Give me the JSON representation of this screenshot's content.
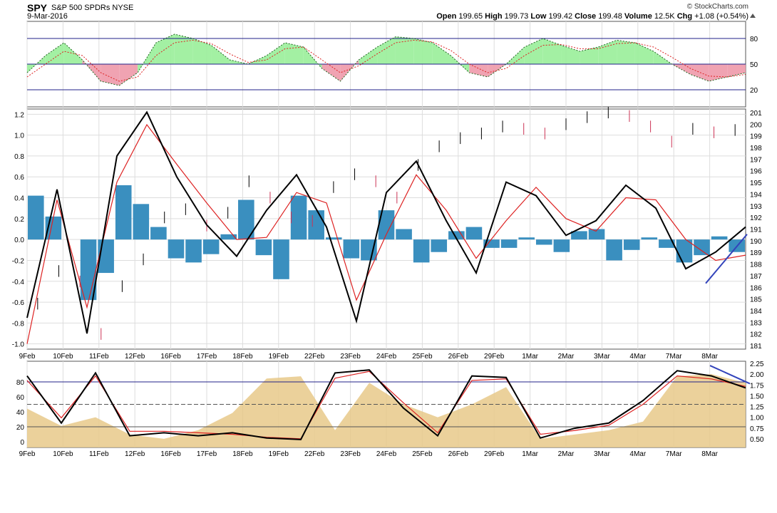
{
  "header": {
    "symbol": "SPY",
    "description": "S&P 500 SPDRs",
    "exchange": "NYSE",
    "date": "9-Mar-2016",
    "brand": "© StockCharts.com",
    "open_label": "Open",
    "open": "199.65",
    "high_label": "High",
    "high": "199.73",
    "low_label": "Low",
    "low": "199.42",
    "close_label": "Close",
    "close": "199.48",
    "volume_label": "Volume",
    "volume": "12.5K",
    "chg_label": "Chg",
    "chg": "+1.08 (+0.54%)"
  },
  "colors": {
    "up": "#000000",
    "down": "#cc3355",
    "macd_hist": "#3a8fbf",
    "signal": "#dd2222",
    "line": "#000000",
    "fill_green": "#99ee99",
    "fill_red": "#ee99aa",
    "vol_fill": "#e8c98a",
    "trend": "#3344bb",
    "hline": "#222288"
  },
  "chart_data": [
    {
      "type": "area",
      "panel": "top-oscillator",
      "y_ticks": [
        "80",
        "50",
        "20"
      ],
      "levels": [
        80,
        50,
        20
      ],
      "ylim": [
        0,
        100
      ],
      "x_categories": [
        "9Feb",
        "10Feb",
        "11Feb",
        "12Feb",
        "16Feb",
        "17Feb",
        "18Feb",
        "19Feb",
        "22Feb",
        "23Feb",
        "24Feb",
        "25Feb",
        "26Feb",
        "29Feb",
        "1Mar",
        "2Mar",
        "3Mar",
        "4Mar",
        "7Mar",
        "8Mar"
      ],
      "series": [
        {
          "values": [
            40,
            60,
            75,
            55,
            30,
            25,
            40,
            75,
            85,
            80,
            72,
            55,
            50,
            60,
            75,
            70,
            45,
            30,
            55,
            70,
            82,
            80,
            75,
            60,
            40,
            35,
            50,
            70,
            80,
            72,
            65,
            70,
            78,
            75,
            65,
            50,
            38,
            30,
            35,
            40
          ]
        },
        {
          "values": [
            35,
            50,
            65,
            60,
            40,
            30,
            35,
            60,
            75,
            78,
            74,
            62,
            52,
            55,
            68,
            70,
            55,
            40,
            48,
            62,
            75,
            78,
            76,
            66,
            50,
            40,
            45,
            60,
            72,
            73,
            68,
            68,
            74,
            75,
            70,
            58,
            45,
            36,
            35,
            38
          ]
        }
      ]
    },
    {
      "type": "line",
      "panel": "price-macd",
      "left_axis_ticks": [
        "1.2",
        "1.0",
        "0.8",
        "0.6",
        "0.4",
        "0.2",
        "0.0",
        "-0.2",
        "-0.4",
        "-0.6",
        "-0.8",
        "-1.0"
      ],
      "left_ylim": [
        -1.05,
        1.25
      ],
      "right_axis_ticks": [
        "201",
        "200",
        "199",
        "198",
        "197",
        "196",
        "195",
        "194",
        "193",
        "192",
        "191",
        "190",
        "189",
        "188",
        "187",
        "186",
        "185",
        "184",
        "183",
        "182",
        "181"
      ],
      "right_ylim": [
        180.7,
        201.3
      ],
      "x_categories": [
        "9Feb",
        "10Feb",
        "11Feb",
        "12Feb",
        "16Feb",
        "17Feb",
        "18Feb",
        "19Feb",
        "22Feb",
        "23Feb",
        "24Feb",
        "25Feb",
        "26Feb",
        "29Feb",
        "1Mar",
        "2Mar",
        "3Mar",
        "4Mar",
        "7Mar",
        "8Mar"
      ],
      "price_close": [
        184.6,
        187.4,
        186.5,
        182.0,
        186.1,
        188.4,
        192.0,
        192.7,
        191.3,
        192.4,
        195.1,
        193.7,
        192.0,
        191.7,
        194.6,
        195.7,
        195.1,
        193.7,
        196.5,
        198.1,
        198.8,
        199.2,
        199.8,
        199.6,
        199.2,
        200.0,
        200.6,
        201.0,
        200.7,
        199.8,
        198.5,
        199.6,
        199.3,
        199.5
      ],
      "macd_hist": [
        0.42,
        0.22,
        0.0,
        -0.58,
        -0.32,
        0.52,
        0.34,
        0.12,
        -0.18,
        -0.22,
        -0.14,
        0.05,
        0.38,
        -0.15,
        -0.38,
        0.42,
        0.28,
        0.02,
        -0.18,
        -0.2,
        0.28,
        0.1,
        -0.22,
        -0.12,
        0.08,
        0.12,
        -0.08,
        -0.08,
        0.02,
        -0.05,
        -0.12,
        0.08,
        0.1,
        -0.2,
        -0.1,
        0.02,
        -0.08,
        -0.22,
        -0.15,
        0.03,
        -0.12
      ],
      "stoch_line": [
        -0.75,
        0.48,
        -0.9,
        0.8,
        1.22,
        0.6,
        0.14,
        -0.16,
        0.28,
        0.62,
        0.12,
        -0.78,
        0.45,
        0.75,
        0.18,
        -0.32,
        0.55,
        0.42,
        0.04,
        0.18,
        0.52,
        0.3,
        -0.28,
        -0.12,
        0.12
      ],
      "signal_line": [
        -1.0,
        0.38,
        -0.65,
        0.55,
        1.1,
        0.72,
        0.35,
        0.0,
        0.02,
        0.45,
        0.35,
        -0.58,
        0.05,
        0.62,
        0.28,
        -0.18,
        0.18,
        0.5,
        0.2,
        0.08,
        0.4,
        0.38,
        0.0,
        -0.2,
        -0.15
      ]
    },
    {
      "type": "line",
      "panel": "bottom-oscillator",
      "left_axis_ticks": [
        "80",
        "60",
        "40",
        "20",
        "0"
      ],
      "left_ylim": [
        0,
        100
      ],
      "right_axis_ticks": [
        "2.25",
        "2.00",
        "1.75",
        "1.50",
        "1.25",
        "1.00",
        "0.75",
        "0.50"
      ],
      "right_ylim": [
        0.3,
        2.3
      ],
      "x_categories": [
        "9Feb",
        "10Feb",
        "11Feb",
        "12Feb",
        "16Feb",
        "17Feb",
        "18Feb",
        "19Feb",
        "22Feb",
        "23Feb",
        "24Feb",
        "25Feb",
        "26Feb",
        "29Feb",
        "1Mar",
        "2Mar",
        "3Mar",
        "4Mar",
        "7Mar",
        "8Mar"
      ],
      "series": [
        {
          "values": [
            88,
            25,
            92,
            8,
            12,
            8,
            12,
            5,
            3,
            92,
            96,
            45,
            8,
            88,
            86,
            5,
            18,
            25,
            55,
            95,
            88,
            72
          ]
        },
        {
          "values": [
            82,
            32,
            88,
            14,
            14,
            12,
            10,
            6,
            4,
            85,
            94,
            52,
            12,
            82,
            84,
            10,
            15,
            22,
            50,
            88,
            84,
            74
          ]
        }
      ],
      "volume_area": [
        1.2,
        0.8,
        1.0,
        0.6,
        0.5,
        0.7,
        1.1,
        1.9,
        1.95,
        0.7,
        1.8,
        1.3,
        1.0,
        1.3,
        1.7,
        0.5,
        0.6,
        0.7,
        0.9,
        1.95,
        2.0,
        1.8
      ]
    }
  ]
}
